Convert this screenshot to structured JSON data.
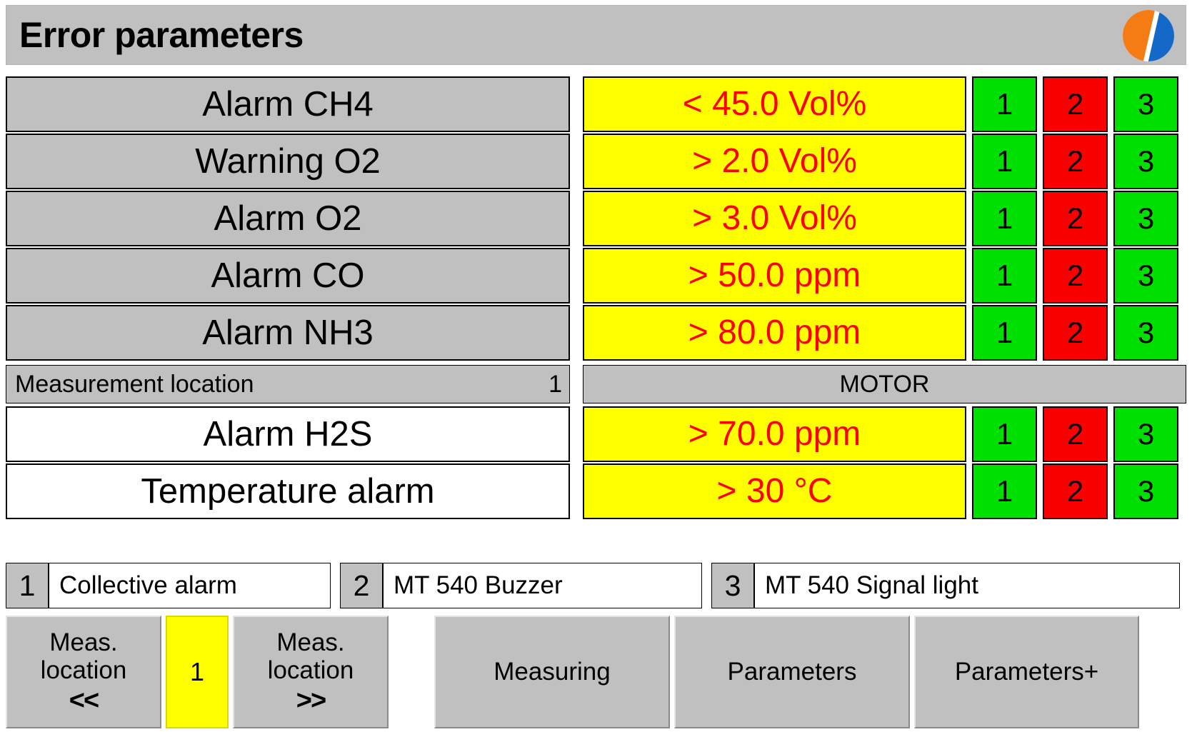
{
  "header": {
    "title": "Error parameters",
    "logo_icon": "company-logo-icon",
    "logo_colors": {
      "left": "#f57c14",
      "right": "#1469c8"
    }
  },
  "colors": {
    "panel_gray": "#c0c0c0",
    "value_yellow": "#ffff00",
    "value_red_text": "#ff0000",
    "status_green": "#00e000",
    "status_red": "#fb0000"
  },
  "alarm_rows": [
    {
      "label": "Alarm CH4",
      "value": "< 45.0 Vol%",
      "label_bg": "gray",
      "indicators": [
        {
          "num": "1",
          "state": "green"
        },
        {
          "num": "2",
          "state": "red"
        },
        {
          "num": "3",
          "state": "green"
        }
      ]
    },
    {
      "label": "Warning O2",
      "value": "> 2.0 Vol%",
      "label_bg": "gray",
      "indicators": [
        {
          "num": "1",
          "state": "green"
        },
        {
          "num": "2",
          "state": "red"
        },
        {
          "num": "3",
          "state": "green"
        }
      ]
    },
    {
      "label": "Alarm O2",
      "value": "> 3.0 Vol%",
      "label_bg": "gray",
      "indicators": [
        {
          "num": "1",
          "state": "green"
        },
        {
          "num": "2",
          "state": "red"
        },
        {
          "num": "3",
          "state": "green"
        }
      ]
    },
    {
      "label": "Alarm CO",
      "value": "> 50.0 ppm",
      "label_bg": "gray",
      "indicators": [
        {
          "num": "1",
          "state": "green"
        },
        {
          "num": "2",
          "state": "red"
        },
        {
          "num": "3",
          "state": "green"
        }
      ]
    },
    {
      "label": "Alarm NH3",
      "value": "> 80.0 ppm",
      "label_bg": "gray",
      "indicators": [
        {
          "num": "1",
          "state": "green"
        },
        {
          "num": "2",
          "state": "red"
        },
        {
          "num": "3",
          "state": "green"
        }
      ]
    },
    {
      "label": "Alarm H2S",
      "value": "> 70.0 ppm",
      "label_bg": "white",
      "indicators": [
        {
          "num": "1",
          "state": "green"
        },
        {
          "num": "2",
          "state": "red"
        },
        {
          "num": "3",
          "state": "green"
        }
      ]
    },
    {
      "label": "Temperature alarm",
      "value": "> 30 °C",
      "label_bg": "white",
      "indicators": [
        {
          "num": "1",
          "state": "green"
        },
        {
          "num": "2",
          "state": "red"
        },
        {
          "num": "3",
          "state": "green"
        }
      ]
    }
  ],
  "measurement_location": {
    "label": "Measurement location",
    "number": "1",
    "name": "MOTOR"
  },
  "legend": [
    {
      "key": "1",
      "text": "Collective alarm"
    },
    {
      "key": "2",
      "text": "MT 540 Buzzer"
    },
    {
      "key": "3",
      "text": "MT 540 Signal light"
    }
  ],
  "buttons": {
    "prev": {
      "line1": "Meas.",
      "line2": "location",
      "arrows": "<<"
    },
    "location_value": "1",
    "next": {
      "line1": "Meas.",
      "line2": "location",
      "arrows": ">>"
    },
    "measuring": "Measuring",
    "parameters": "Parameters",
    "parameters_plus": "Parameters+"
  }
}
